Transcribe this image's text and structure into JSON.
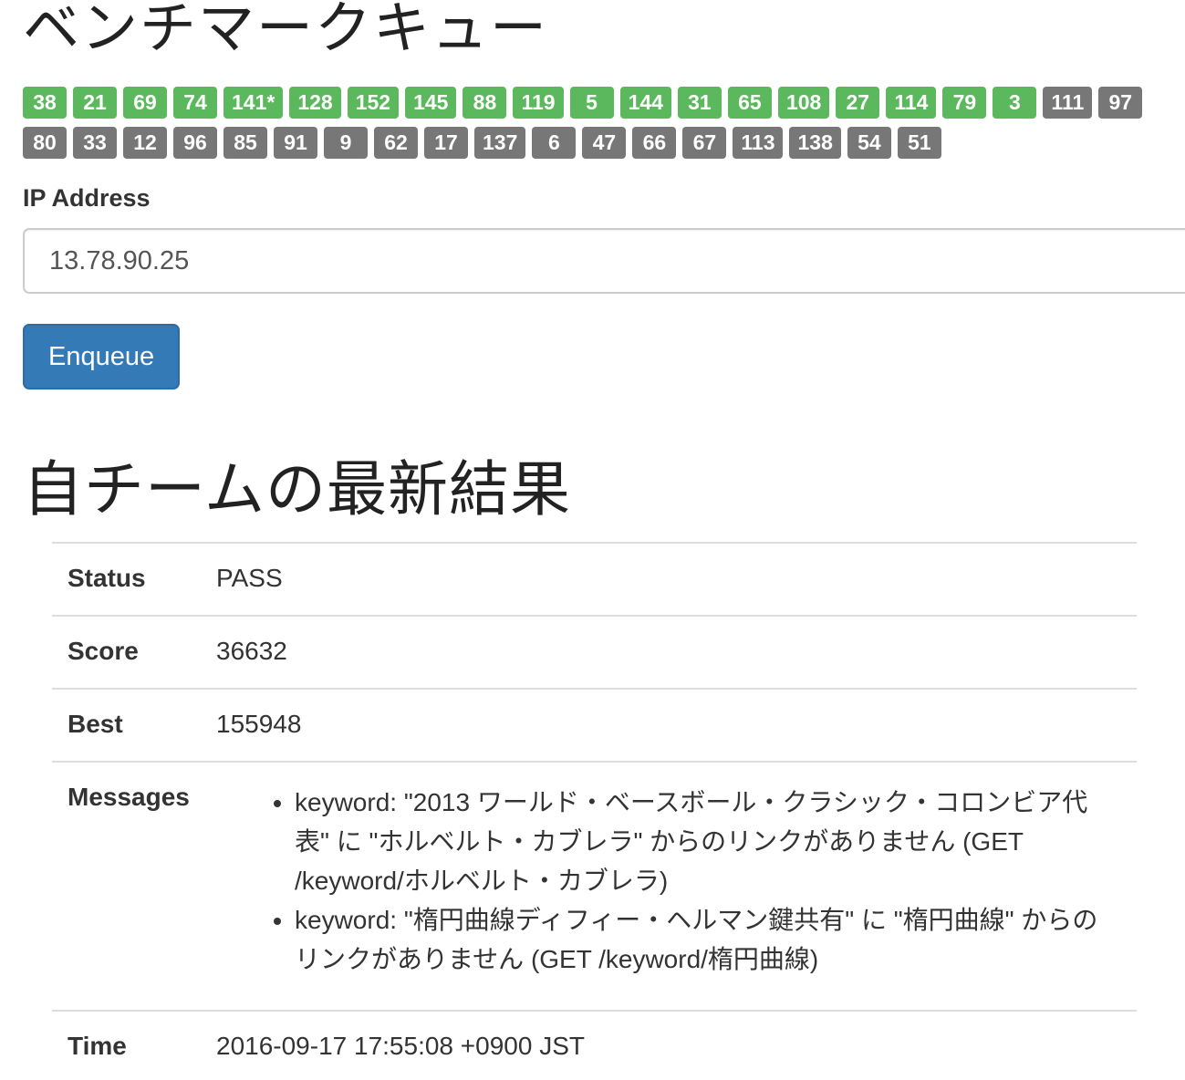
{
  "queue": {
    "title": "ベンチマークキュー",
    "done_badges": [
      "38",
      "21",
      "69",
      "74",
      "141*",
      "128",
      "152",
      "145",
      "88",
      "119",
      "5",
      "144",
      "31",
      "65",
      "108",
      "27",
      "114",
      "79",
      "3"
    ],
    "waiting_badges": [
      "111",
      "97",
      "80",
      "33",
      "12",
      "96",
      "85",
      "91",
      "9",
      "62",
      "17",
      "137",
      "6",
      "47",
      "66",
      "67",
      "113",
      "138",
      "54",
      "51"
    ]
  },
  "form": {
    "ip_label": "IP Address",
    "ip_value": "13.78.90.25",
    "enqueue_label": "Enqueue"
  },
  "results": {
    "title": "自チームの最新結果",
    "status_label": "Status",
    "status_value": "PASS",
    "score_label": "Score",
    "score_value": "36632",
    "best_label": "Best",
    "best_value": "155948",
    "messages_label": "Messages",
    "messages": [
      "keyword: \"2013 ワールド・ベースボール・クラシック・コロンビア代表\" に \"ホルベルト・カブレラ\" からのリンクがありません (GET /keyword/ホルベルト・カブレラ)",
      "keyword: \"楕円曲線ディフィー・ヘルマン鍵共有\" に \"楕円曲線\" からのリンクがありません (GET /keyword/楕円曲線)"
    ],
    "time_label": "Time",
    "time_value": "2016-09-17 17:55:08 +0900 JST"
  },
  "colors": {
    "done_badge": "#5cb85c",
    "waiting_badge": "#777777",
    "primary_button": "#337ab7"
  }
}
